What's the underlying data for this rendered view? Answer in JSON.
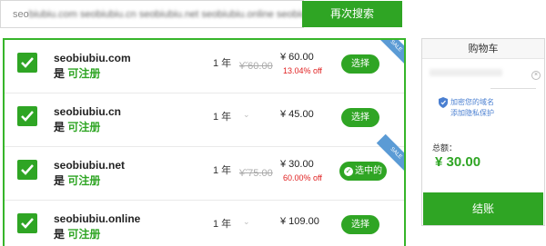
{
  "search": {
    "value_visible": "seo",
    "value_obscured": "biubiu.com seobiubiu.cn seobiubiu.net seobiubiu.online seobiubiu.site",
    "button_label": "再次搜索"
  },
  "results": [
    {
      "domain": "seobiubiu.com",
      "status_prefix": "是",
      "status": "可注册",
      "period": "1 年",
      "price": "¥ 60.00",
      "old_price": "¥ 60.00",
      "discount": "13.04% off",
      "action": "选择",
      "selected": false,
      "sale": "SALE"
    },
    {
      "domain": "seobiubiu.cn",
      "status_prefix": "是",
      "status": "可注册",
      "period": "1 年",
      "price": "¥ 45.00",
      "old_price": "",
      "discount": "",
      "action": "选择",
      "selected": false,
      "sale": ""
    },
    {
      "domain": "seobiubiu.net",
      "status_prefix": "是",
      "status": "可注册",
      "period": "1 年",
      "price": "¥ 30.00",
      "old_price": "¥ 75.00",
      "discount": "60.00% off",
      "action": "选中的",
      "selected": true,
      "sale": "SALE"
    },
    {
      "domain": "seobiubiu.online",
      "status_prefix": "是",
      "status": "可注册",
      "period": "1 年",
      "price": "¥ 109.00",
      "old_price": "",
      "discount": "",
      "action": "选择",
      "selected": false,
      "sale": ""
    }
  ],
  "cart": {
    "title": "购物车",
    "privacy_line1": "加密您的域名",
    "privacy_line2": "添加隐私保护",
    "total_label": "总额：",
    "total_value": "¥ 30.00",
    "checkout_label": "结账"
  },
  "colors": {
    "accent": "#2fa524",
    "discount": "#e02020",
    "link": "#4a7fd1",
    "sale_badge": "#5b9bd5"
  },
  "icons": {
    "check": "check-icon",
    "chevron": "chevron-down-icon",
    "shield": "shield-icon",
    "close": "close-icon",
    "tick": "check-circle-icon"
  }
}
